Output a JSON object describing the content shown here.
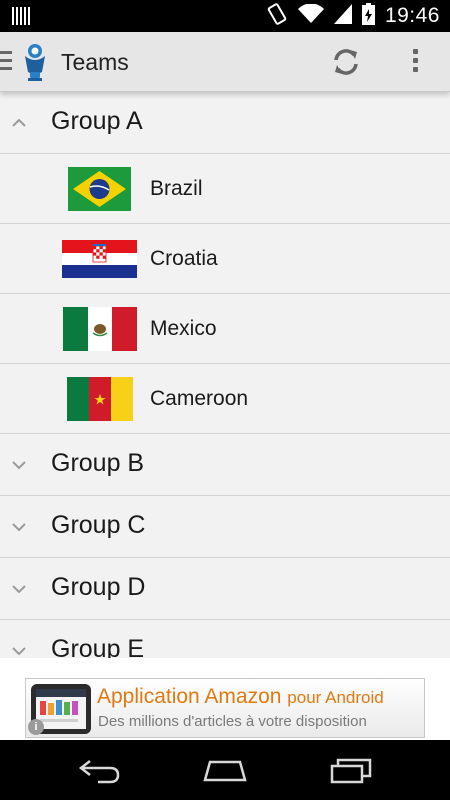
{
  "status_bar": {
    "time": "19:46",
    "icons": [
      "barcode-icon",
      "vibrate-icon",
      "wifi-icon",
      "signal-icon",
      "battery-icon"
    ]
  },
  "action_bar": {
    "title": "Teams",
    "icons": [
      "drawer-icon",
      "app-logo-icon",
      "refresh-icon",
      "overflow-menu-icon"
    ]
  },
  "groups": [
    {
      "label": "Group A",
      "expanded": true,
      "teams": [
        {
          "name": "Brazil",
          "flag": "brazil-flag-icon"
        },
        {
          "name": "Croatia",
          "flag": "croatia-flag-icon"
        },
        {
          "name": "Mexico",
          "flag": "mexico-flag-icon"
        },
        {
          "name": "Cameroon",
          "flag": "cameroon-flag-icon"
        }
      ]
    },
    {
      "label": "Group B",
      "expanded": false
    },
    {
      "label": "Group C",
      "expanded": false
    },
    {
      "label": "Group D",
      "expanded": false
    },
    {
      "label": "Group E",
      "expanded": false
    }
  ],
  "ad": {
    "headline": "Application Amazon",
    "headline_suffix": "pour Android",
    "subline": "Des millions d'articles à votre disposition",
    "colors": {
      "headline": "#e07a10",
      "subline": "#7a7a7a"
    }
  },
  "nav_bar": {
    "buttons": [
      "back-icon",
      "home-icon",
      "recent-apps-icon"
    ]
  },
  "colors": {
    "action_bar_bg": "#e6e6e6",
    "list_bg": "#f2f2f2",
    "divider": "#d4d4d4"
  }
}
